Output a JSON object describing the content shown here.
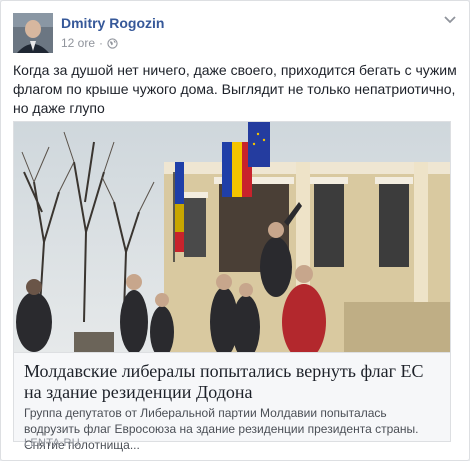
{
  "post": {
    "author": "Dmitry Rogozin",
    "time": "12 ore",
    "separator": "·",
    "audience_icon": "globe-icon",
    "text": "Когда за душой нет ничего, даже своего, приходится бегать с чужим флагом по крыше чужого дома. Выглядит не только непатриотично, но даже глупо"
  },
  "link": {
    "title": "Молдавские либералы попытались вернуть флаг ЕС на здание резиденции Додона",
    "description": "Группа депутатов от Либеральной партии Молдавии попыталась водрузить флаг Евросоюза на здание резиденции президента страны. Снятие полотнища...",
    "source": "LENTA.RU"
  },
  "colors": {
    "author": "#365899",
    "meta": "#90949c",
    "text": "#1d2129",
    "link_bg": "#f6f7f9"
  }
}
